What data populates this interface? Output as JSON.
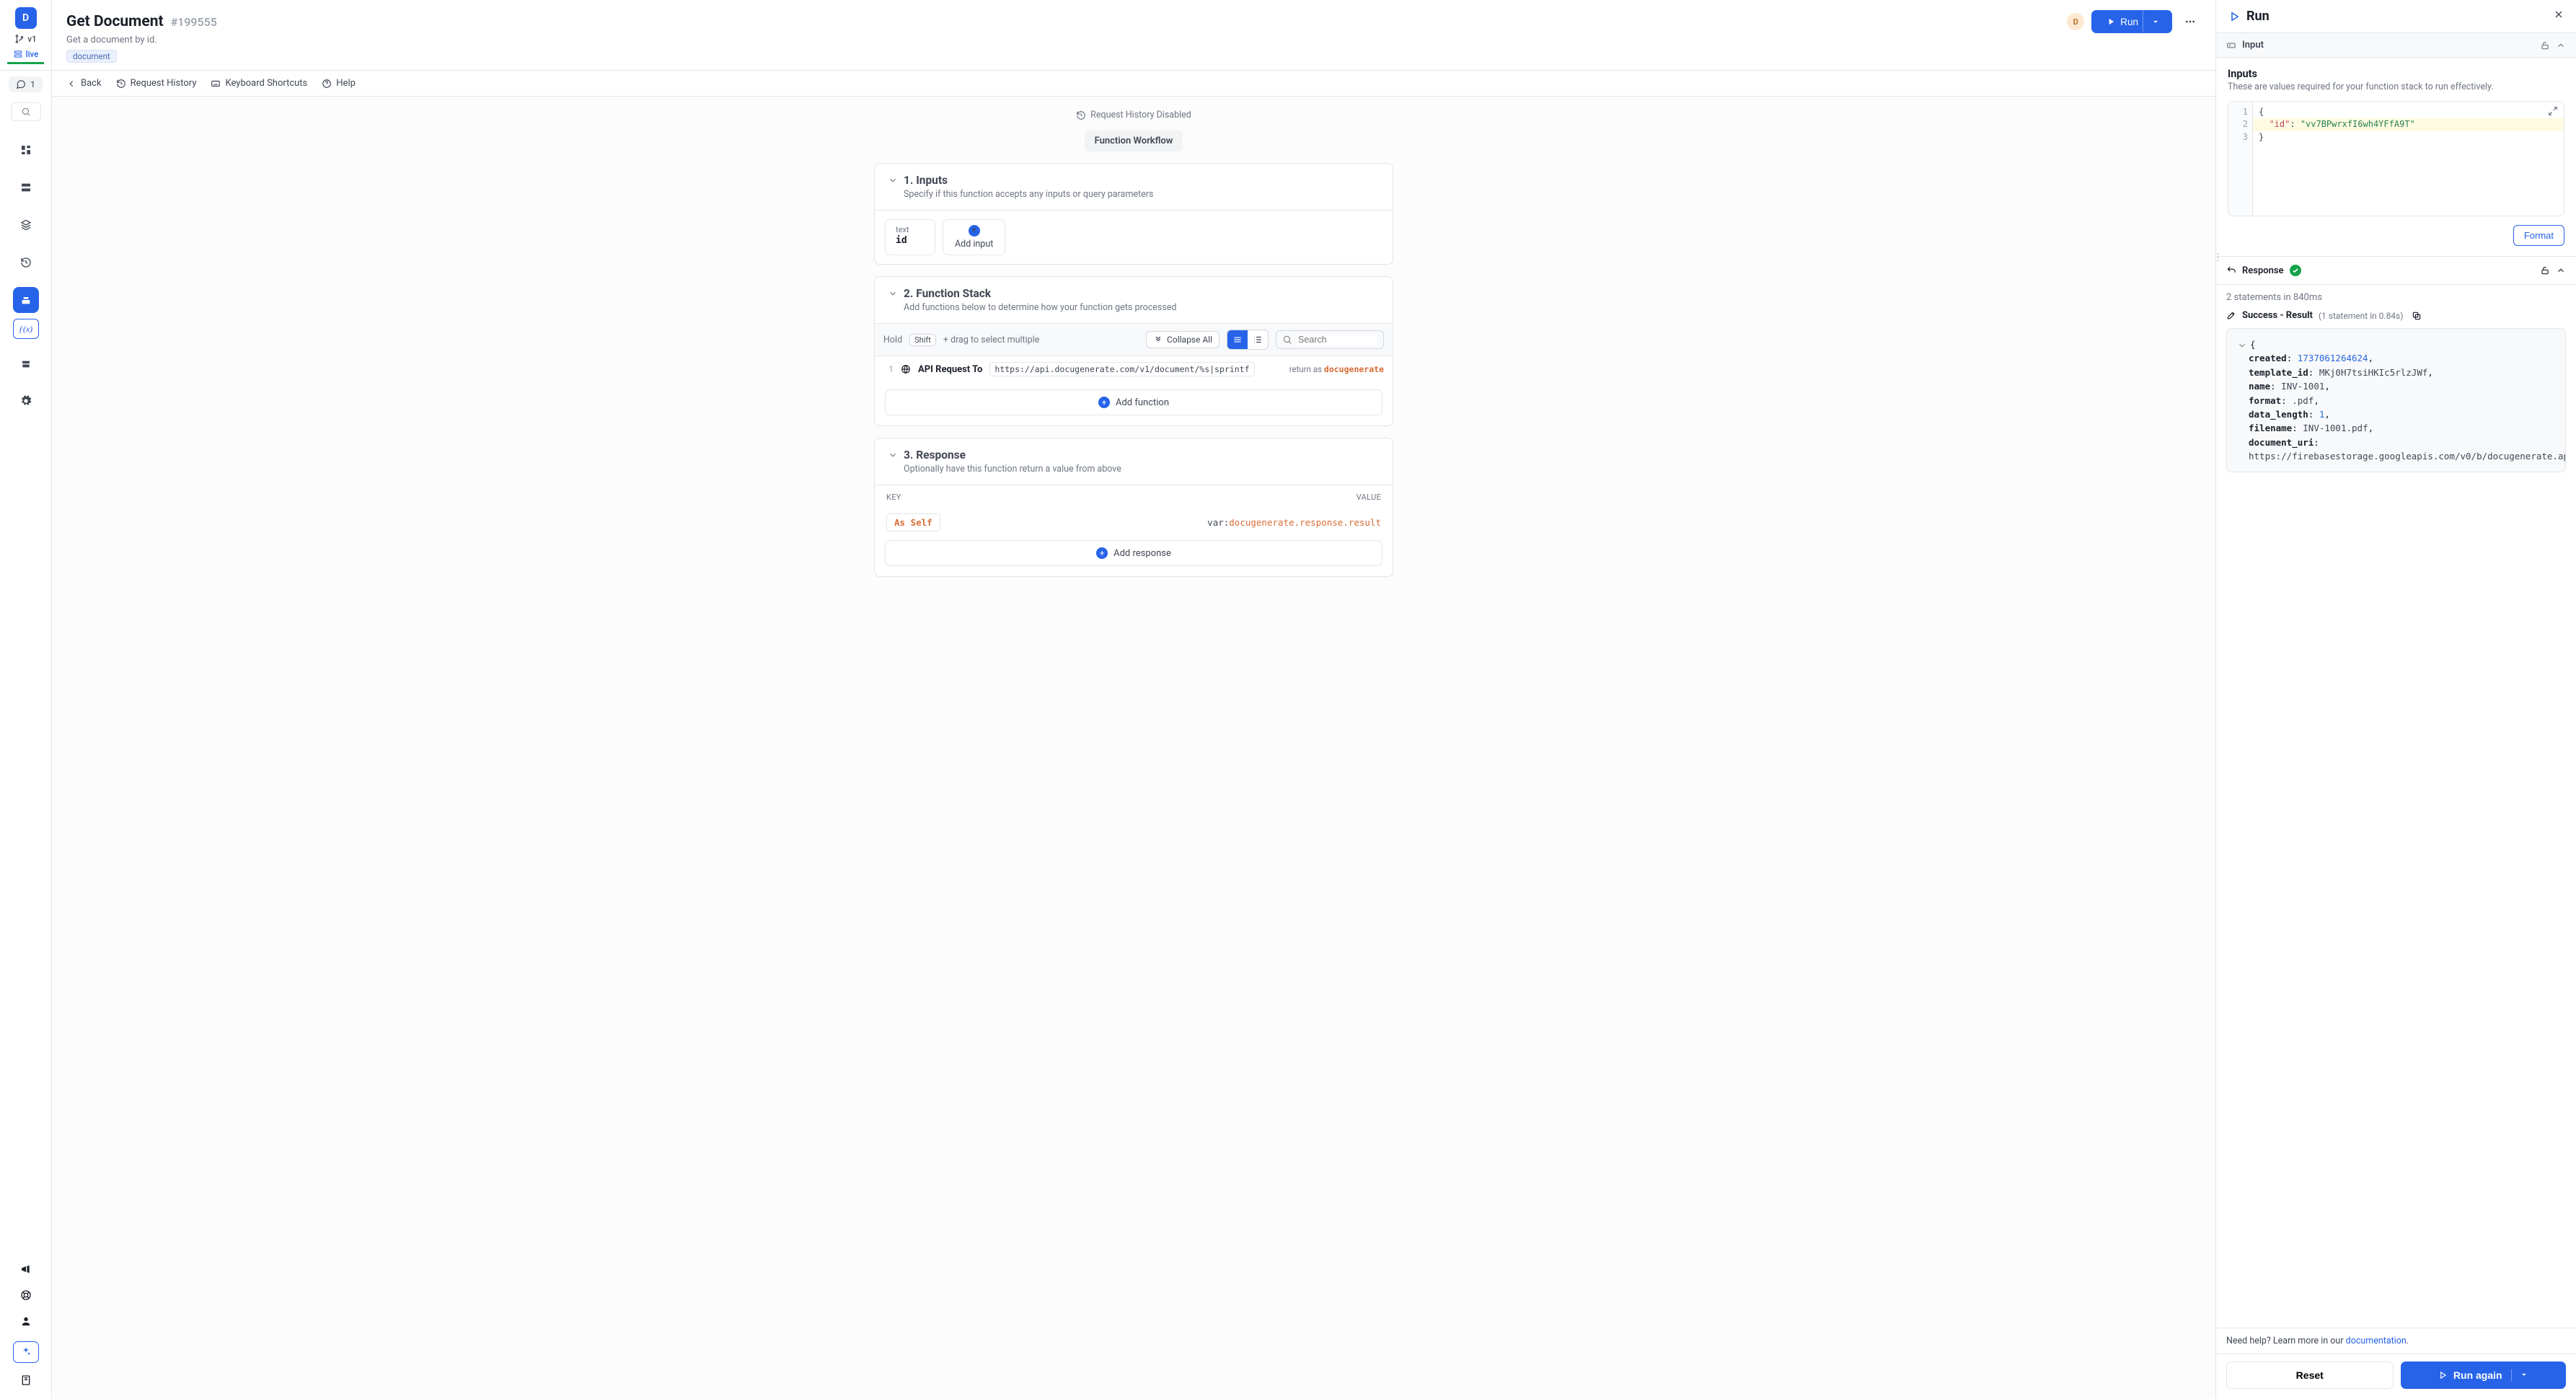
{
  "sidebar": {
    "workspace_initial": "D",
    "branch_label": "v1",
    "env_label": "live",
    "chat_count": "1"
  },
  "header": {
    "title": "Get Document",
    "id_hash": "#199555",
    "subtitle": "Get a document by id.",
    "tag": "document",
    "avatar_initial": "D",
    "run_label": "Run"
  },
  "toolbar": {
    "back": "Back",
    "request_history": "Request History",
    "keyboard_shortcuts": "Keyboard Shortcuts",
    "help": "Help"
  },
  "canvas": {
    "history_disabled": "Request History Disabled",
    "workflow_pill": "Function Workflow"
  },
  "inputs_card": {
    "title": "1. Inputs",
    "subtitle": "Specify if this function accepts any inputs or query parameters",
    "items": [
      {
        "type": "text",
        "name": "id"
      }
    ],
    "add_label": "Add input"
  },
  "stack_card": {
    "title": "2. Function Stack",
    "subtitle": "Add functions below to determine how your function gets processed",
    "hold": "Hold",
    "shift": "Shift",
    "drag_text": "+ drag to select multiple",
    "collapse_label": "Collapse All",
    "search_placeholder": "Search",
    "rows": [
      {
        "idx": "1",
        "label": "API Request To",
        "code": "https://api.docugenerate.com/v1/document/%s|sprintf",
        "return_prefix": "return as ",
        "return_var": "docugenerate"
      }
    ],
    "add_function": "Add function"
  },
  "response_card": {
    "title": "3. Response",
    "subtitle": "Optionally have this function return a value from above",
    "key_header": "KEY",
    "value_header": "VALUE",
    "key_chip": "As Self",
    "value_prefix": "var:",
    "value_expr": "docugenerate.response.result",
    "add_response": "Add response"
  },
  "run_panel": {
    "title": "Run",
    "input_section": "Input",
    "inputs_heading": "Inputs",
    "inputs_sub": "These are values required for your function stack to run effectively.",
    "editor": {
      "lines": [
        "1",
        "2",
        "3"
      ],
      "row1": "{",
      "row2_key": "\"id\"",
      "row2_colon": ": ",
      "row2_val": "\"vv7BPwrxfI6wh4YFfA9T\"",
      "row3": "}"
    },
    "format_btn": "Format",
    "response_label": "Response",
    "stats": "2 statements in 840ms",
    "success_prefix": "Success - Result ",
    "success_detail": "(1 statement in 0.84s)",
    "result": {
      "created_key": "created",
      "created_val": "1737061264624",
      "template_id_key": "template_id",
      "template_id_val": "MKj0H7tsiHKIc5rlzJWf",
      "name_key": "name",
      "name_val": "INV-1001",
      "format_key": "format",
      "format_val": ".pdf",
      "data_length_key": "data_length",
      "data_length_val": "1",
      "filename_key": "filename",
      "filename_val": "INV-1001.pdf",
      "document_uri_key": "document_uri",
      "document_uri_val": "https://firebasestorage.googleapis.com/v0/b/docugenerate.ap"
    },
    "help_prefix": "Need help? Learn more in our ",
    "help_link": "documentation",
    "reset": "Reset",
    "run_again": "Run again"
  }
}
